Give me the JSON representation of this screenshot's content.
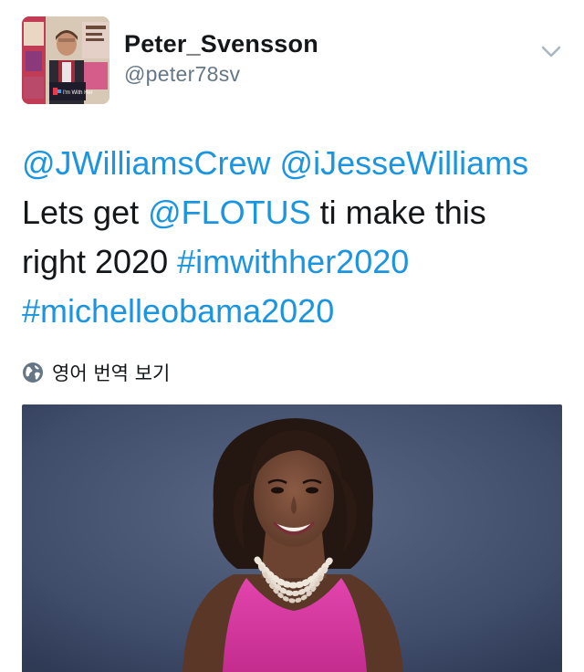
{
  "author": {
    "display_name": "Peter_Svensson",
    "handle": "@peter78sv",
    "avatar": {
      "icon": "user-photo",
      "sign_text": "I'm With Her"
    }
  },
  "menu": {
    "icon": "chevron-down-icon"
  },
  "tweet": {
    "line1": {
      "mention1": "@JWilliamsCrew",
      "mention2": "@iJesseWilliams"
    },
    "line2": {
      "text_before": "Lets get ",
      "mention": "@FLOTUS",
      "text_after": " ti make this"
    },
    "line3": {
      "text_before": "right 2020 ",
      "hashtag": "#imwithher2020"
    },
    "line4": {
      "hashtag": "#michelleobama2020"
    }
  },
  "translate": {
    "icon": "globe-icon",
    "label": "영어 번역 보기"
  },
  "media": {
    "type": "photo",
    "icon": "portrait-photo"
  },
  "colors": {
    "link": "#1b95e0",
    "text": "#14171a",
    "secondary": "#657786",
    "photo_background": "#3d4a66",
    "dress": "#d0359a"
  }
}
